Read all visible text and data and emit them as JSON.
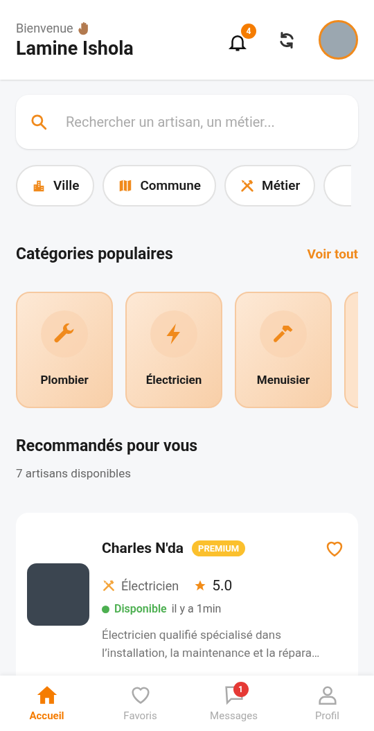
{
  "header": {
    "greeting": "Bienvenue",
    "user_name": "Lamine Ishola",
    "notification_count": "4"
  },
  "search": {
    "placeholder": "Rechercher un artisan, un métier..."
  },
  "filters": [
    {
      "kind": "city",
      "label": "Ville"
    },
    {
      "kind": "map",
      "label": "Commune"
    },
    {
      "kind": "trade",
      "label": "Métier"
    }
  ],
  "categories_section": {
    "title": "Catégories populaires",
    "see_all": "Voir tout"
  },
  "categories": [
    {
      "kind": "wrench",
      "label": "Plombier"
    },
    {
      "kind": "bolt",
      "label": "Électricien"
    },
    {
      "kind": "hammer",
      "label": "Menuisier"
    }
  ],
  "recommended": {
    "title": "Recommandés pour vous",
    "subtitle": "7 artisans disponibles"
  },
  "artisans": [
    {
      "name": "Charles N'da",
      "badge": "PREMIUM",
      "favorite": false,
      "trade": "Électricien",
      "rating": "5.0",
      "available": true,
      "availability": "Disponible",
      "last_seen": "il y a 1min",
      "description": "Électricien qualifié spécialisé dans l’installation, la maintenance et la répara…"
    }
  ],
  "nav": [
    {
      "kind": "home",
      "label": "Accueil",
      "selected": true
    },
    {
      "kind": "heart",
      "label": "Favoris",
      "selected": false
    },
    {
      "kind": "messages",
      "label": "Messages",
      "selected": false,
      "badge": "1"
    },
    {
      "kind": "profile",
      "label": "Profil",
      "selected": false
    }
  ]
}
